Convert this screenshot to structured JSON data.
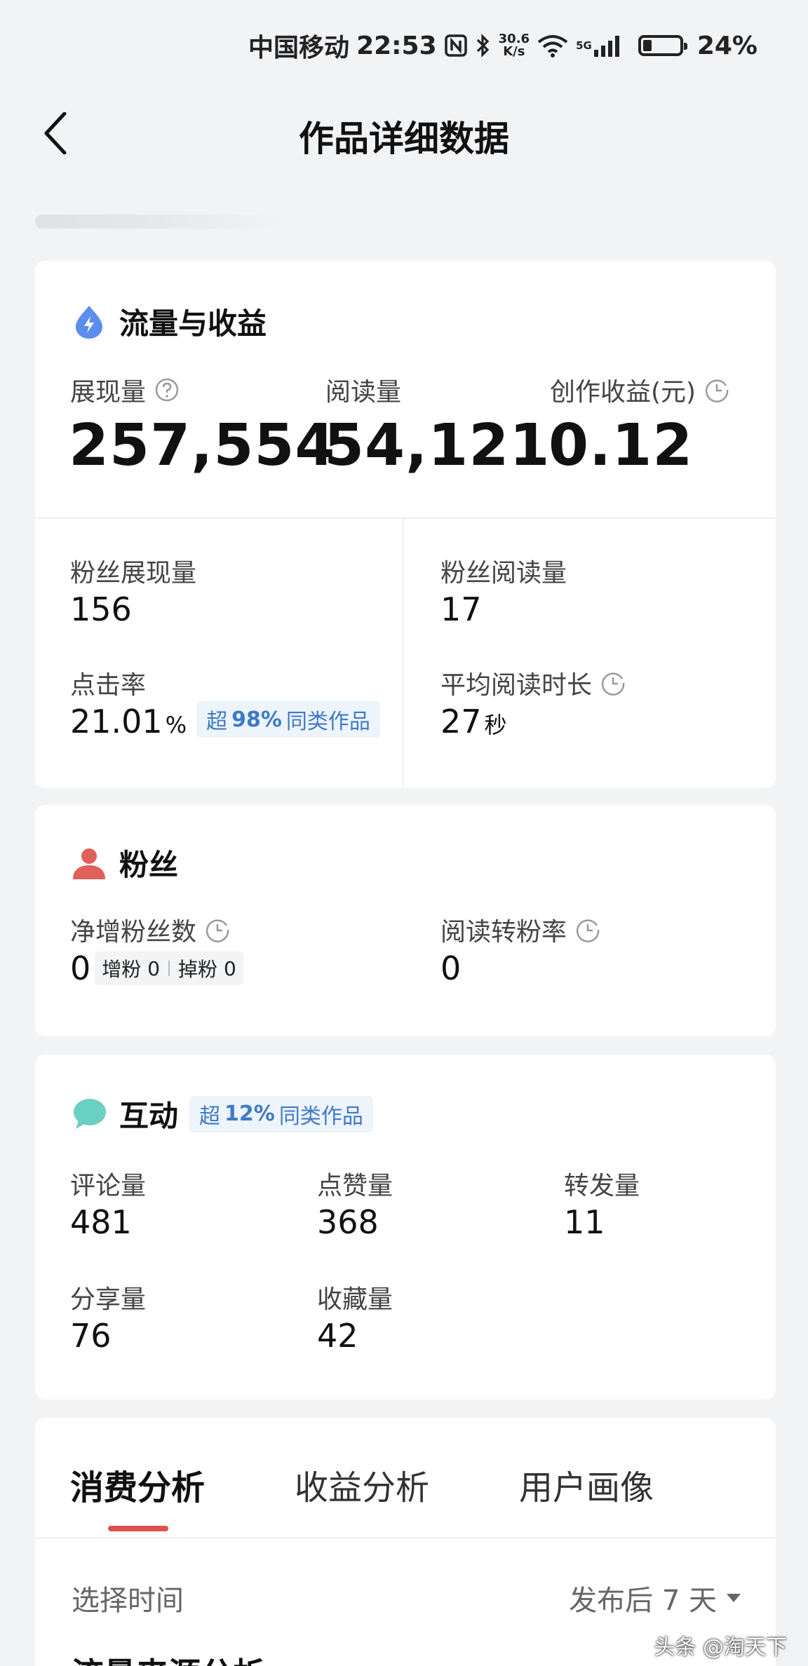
{
  "status_bar": {
    "carrier": "中国移动",
    "time": "22:53",
    "net_speed_value": "30.6",
    "net_speed_unit": "K/s",
    "network_type": "5G",
    "battery": "24%",
    "icons": [
      "nfc-icon",
      "bluetooth-icon",
      "wifi-icon",
      "signal-icon",
      "battery-icon"
    ]
  },
  "nav": {
    "title": "作品详细数据",
    "back_icon": "back-chevron-icon"
  },
  "traffic": {
    "title": "流量与收益",
    "icon": "lightning-drop-icon",
    "accent_color": "#5b8def",
    "impressions_label": "展现量",
    "impressions_value": "257,554",
    "reads_label": "阅读量",
    "reads_value": "54,121",
    "earnings_label": "创作收益(元)",
    "earnings_value": "0.12",
    "fan_impressions_label": "粉丝展现量",
    "fan_impressions_value": "156",
    "fan_reads_label": "粉丝阅读量",
    "fan_reads_value": "17",
    "ctr_label": "点击率",
    "ctr_value": "21.01",
    "ctr_unit": "%",
    "ctr_badge_prefix": "超",
    "ctr_badge_percent": "98%",
    "ctr_badge_suffix": "同类作品",
    "avg_read_label": "平均阅读时长",
    "avg_read_value": "27",
    "avg_read_unit": "秒"
  },
  "fans": {
    "title": "粉丝",
    "icon": "person-icon",
    "accent_color": "#e0605a",
    "net_gain_label": "净增粉丝数",
    "net_gain_value": "0",
    "gain_label": "增粉",
    "gain_value": "0",
    "loss_label": "掉粉",
    "loss_value": "0",
    "conversion_label": "阅读转粉率",
    "conversion_value": "0"
  },
  "interaction": {
    "title": "互动",
    "icon": "chat-bubble-icon",
    "accent_color": "#6ad0c4",
    "badge_prefix": "超",
    "badge_percent": "12%",
    "badge_suffix": "同类作品",
    "comments_label": "评论量",
    "comments_value": "481",
    "likes_label": "点赞量",
    "likes_value": "368",
    "reposts_label": "转发量",
    "reposts_value": "11",
    "shares_label": "分享量",
    "shares_value": "76",
    "favorites_label": "收藏量",
    "favorites_value": "42"
  },
  "analysis": {
    "tabs": [
      "消费分析",
      "收益分析",
      "用户画像"
    ],
    "active_tab": 0,
    "active_color": "#e0514b",
    "select_label": "选择时间",
    "select_value": "发布后 7 天",
    "section_heading": "流量来源分析"
  },
  "watermark": "头条 @淘天下"
}
